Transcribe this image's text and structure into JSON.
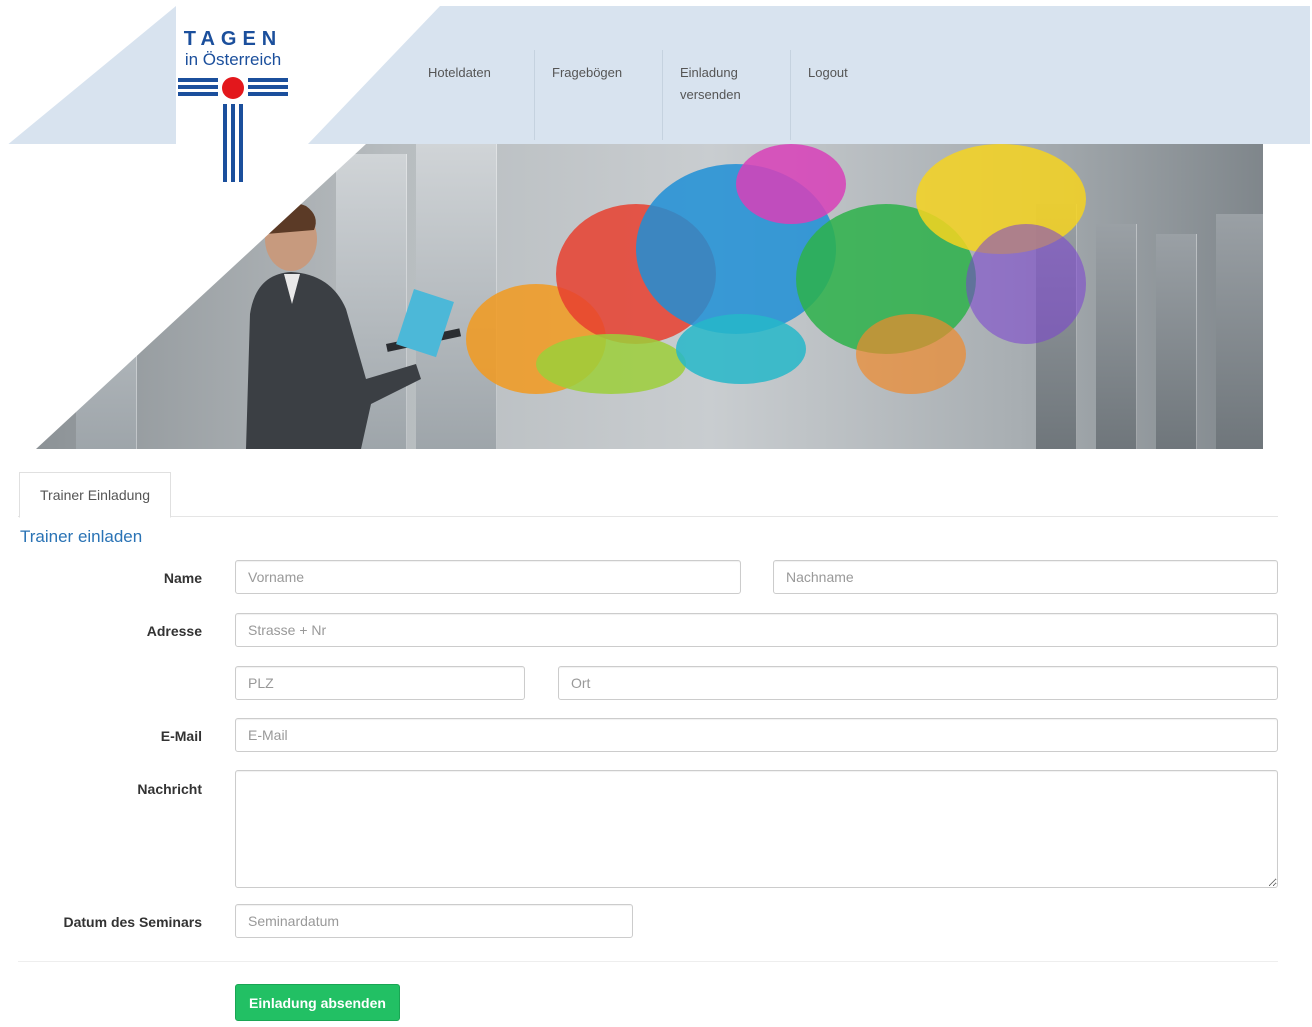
{
  "logo": {
    "title": "TAGEN",
    "subtitle": "in Österreich",
    "colors": {
      "blue": "#1b4f9c",
      "red": "#e3171c"
    }
  },
  "nav": {
    "items": [
      {
        "label": "Hoteldaten"
      },
      {
        "label": "Fragebögen"
      },
      {
        "label": "Einladung versenden"
      },
      {
        "label": "Logout"
      }
    ]
  },
  "hero": {
    "icon": "businessman-laptop-paint-splash-image"
  },
  "tabs": [
    {
      "label": "Trainer Einladung",
      "active": true
    }
  ],
  "form": {
    "title": "Trainer einladen",
    "name_label": "Name",
    "vorname_placeholder": "Vorname",
    "nachname_placeholder": "Nachname",
    "adresse_label": "Adresse",
    "strasse_placeholder": "Strasse + Nr",
    "plz_placeholder": "PLZ",
    "ort_placeholder": "Ort",
    "email_label": "E-Mail",
    "email_placeholder": "E-Mail",
    "nachricht_label": "Nachricht",
    "datum_label": "Datum des Seminars",
    "datum_placeholder": "Seminardatum",
    "submit_label": "Einladung absenden"
  },
  "colors": {
    "header_bg": "#d8e3ef",
    "accent_blue": "#2a73b5",
    "button_green": "#22c064"
  }
}
